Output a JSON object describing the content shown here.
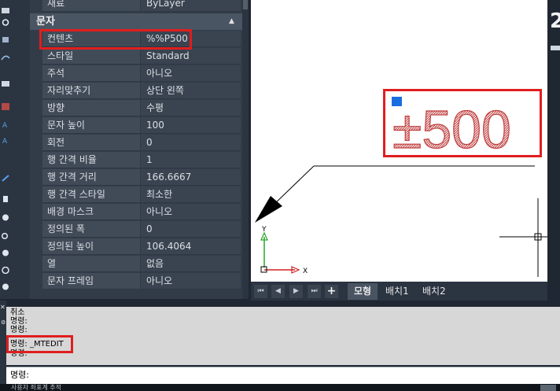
{
  "colors": {
    "accent_red": "#e01e1e",
    "mtext_hatch": "#c04040",
    "grip_blue": "#1a6ee0",
    "ucs_green": "#2aa62a",
    "ucs_red": "#d22020"
  },
  "icons": [
    "refresh-icon",
    "copy-icon",
    "curve-icon",
    "select-icon",
    "hatch-icon",
    "text-a-icon",
    "text-a2-icon",
    "edit-icon",
    "hand-icon",
    "clock-icon",
    "zoom-icon",
    "layers-icon",
    "orbit-icon",
    "target-icon"
  ],
  "panel": {
    "top_value": "ByLayer",
    "top_label_partial": "재료",
    "section_title": "문자",
    "section_arrow": "▲",
    "rows": [
      {
        "label": "컨텐츠",
        "value": "%%P500"
      },
      {
        "label": "스타일",
        "value": "Standard"
      },
      {
        "label": "주석",
        "value": "아니오"
      },
      {
        "label": "자리맞추기",
        "value": "상단 왼쪽"
      },
      {
        "label": "방향",
        "value": "수평"
      },
      {
        "label": "문자 높이",
        "value": "100"
      },
      {
        "label": "회전",
        "value": "0"
      },
      {
        "label": "행 간격 비율",
        "value": "1"
      },
      {
        "label": "행 간격 거리",
        "value": "166.6667"
      },
      {
        "label": "행 간격 스타일",
        "value": "최소한"
      },
      {
        "label": "배경 마스크",
        "value": "아니오"
      },
      {
        "label": "정의된 폭",
        "value": "0"
      },
      {
        "label": "정의된 높이",
        "value": "106.4064"
      },
      {
        "label": "열",
        "value": "없음"
      },
      {
        "label": "문자 프레임",
        "value": "아니오"
      }
    ]
  },
  "canvas": {
    "mtext": "±500",
    "ucs_y": "Y",
    "ucs_x": "X"
  },
  "layout_tabs": {
    "nav": [
      "⏮",
      "◀",
      "▶",
      "⏭"
    ],
    "add": "+",
    "tabs": [
      "모형",
      "배치1",
      "배치2"
    ]
  },
  "command": {
    "history": [
      "취소",
      "명령:",
      "명령:",
      "명령: _MTEDIT",
      "명령:"
    ],
    "prompt": "명령:",
    "status_text": "사용자 좌표계 추적"
  },
  "right_edge_glyph": "2"
}
